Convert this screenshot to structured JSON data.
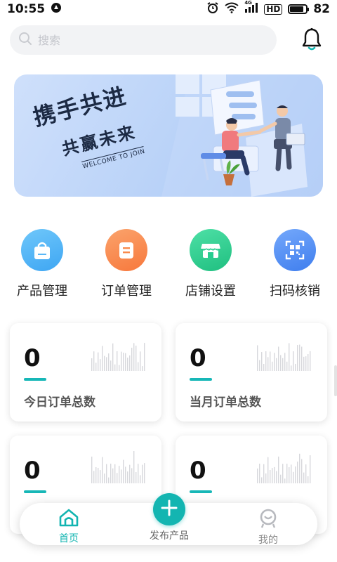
{
  "status_bar": {
    "time": "10:55",
    "network": "4G",
    "hd": "HD",
    "battery_text": "82",
    "battery_level": 0.82
  },
  "search": {
    "placeholder": "搜索"
  },
  "banner": {
    "title": "携手共进",
    "subtitle": "共赢未来",
    "english": "WELCOME TO JOIN"
  },
  "quick_menu": [
    {
      "label": "产品管理",
      "icon": "shopping-bag-icon",
      "color": "#48b4f7"
    },
    {
      "label": "订单管理",
      "icon": "order-list-icon",
      "color": "#f98a4c"
    },
    {
      "label": "店铺设置",
      "icon": "store-icon",
      "color": "#27cd8f"
    },
    {
      "label": "扫码核销",
      "icon": "qr-scan-icon",
      "color": "#4c8cf3"
    }
  ],
  "stats": [
    {
      "value": "0",
      "label": "今日订单总数"
    },
    {
      "value": "0",
      "label": "当月订单总数"
    },
    {
      "value": "0",
      "label": ""
    },
    {
      "value": "0",
      "label": ""
    }
  ],
  "bottom_nav": {
    "home": {
      "label": "首页",
      "icon": "home-icon"
    },
    "publish": {
      "label": "发布产品",
      "icon": "plus-icon"
    },
    "mine": {
      "label": "我的",
      "icon": "profile-icon"
    },
    "accent_color": "#13b5b1"
  }
}
